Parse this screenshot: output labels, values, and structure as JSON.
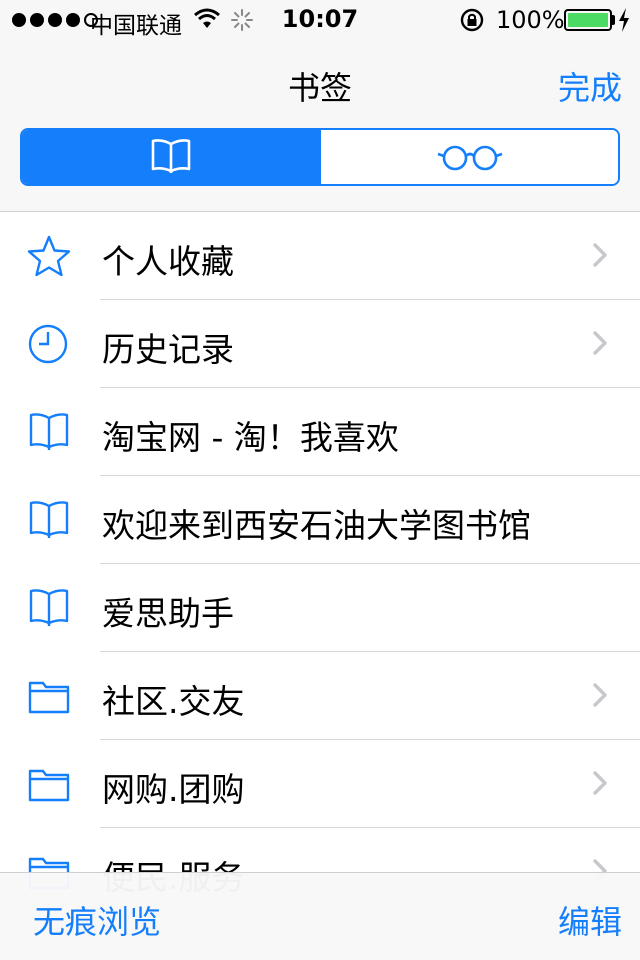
{
  "status_bar": {
    "carrier": "中国联通",
    "time": "10:07",
    "battery": "100%"
  },
  "nav": {
    "title": "书签",
    "done": "完成"
  },
  "segments": [
    {
      "icon": "book-icon",
      "selected": true
    },
    {
      "icon": "glasses-icon",
      "selected": false
    }
  ],
  "list": {
    "items": [
      {
        "label": "个人收藏",
        "icon": "star-icon",
        "chevron": true
      },
      {
        "label": "历史记录",
        "icon": "clock-icon",
        "chevron": true
      },
      {
        "label": "淘宝网 - 淘！我喜欢",
        "icon": "book-icon",
        "chevron": false
      },
      {
        "label": "欢迎来到西安石油大学图书馆",
        "icon": "book-icon",
        "chevron": false
      },
      {
        "label": "爱思助手",
        "icon": "book-icon",
        "chevron": false
      },
      {
        "label": "社区.交友",
        "icon": "folder-icon",
        "chevron": true
      },
      {
        "label": "网购.团购",
        "icon": "folder-icon",
        "chevron": true
      },
      {
        "label": "便民.服务",
        "icon": "folder-icon",
        "chevron": true
      }
    ]
  },
  "toolbar": {
    "private": "无痕浏览",
    "edit": "编辑"
  },
  "colors": {
    "accent": "#157efb",
    "battery": "#4cd964"
  }
}
